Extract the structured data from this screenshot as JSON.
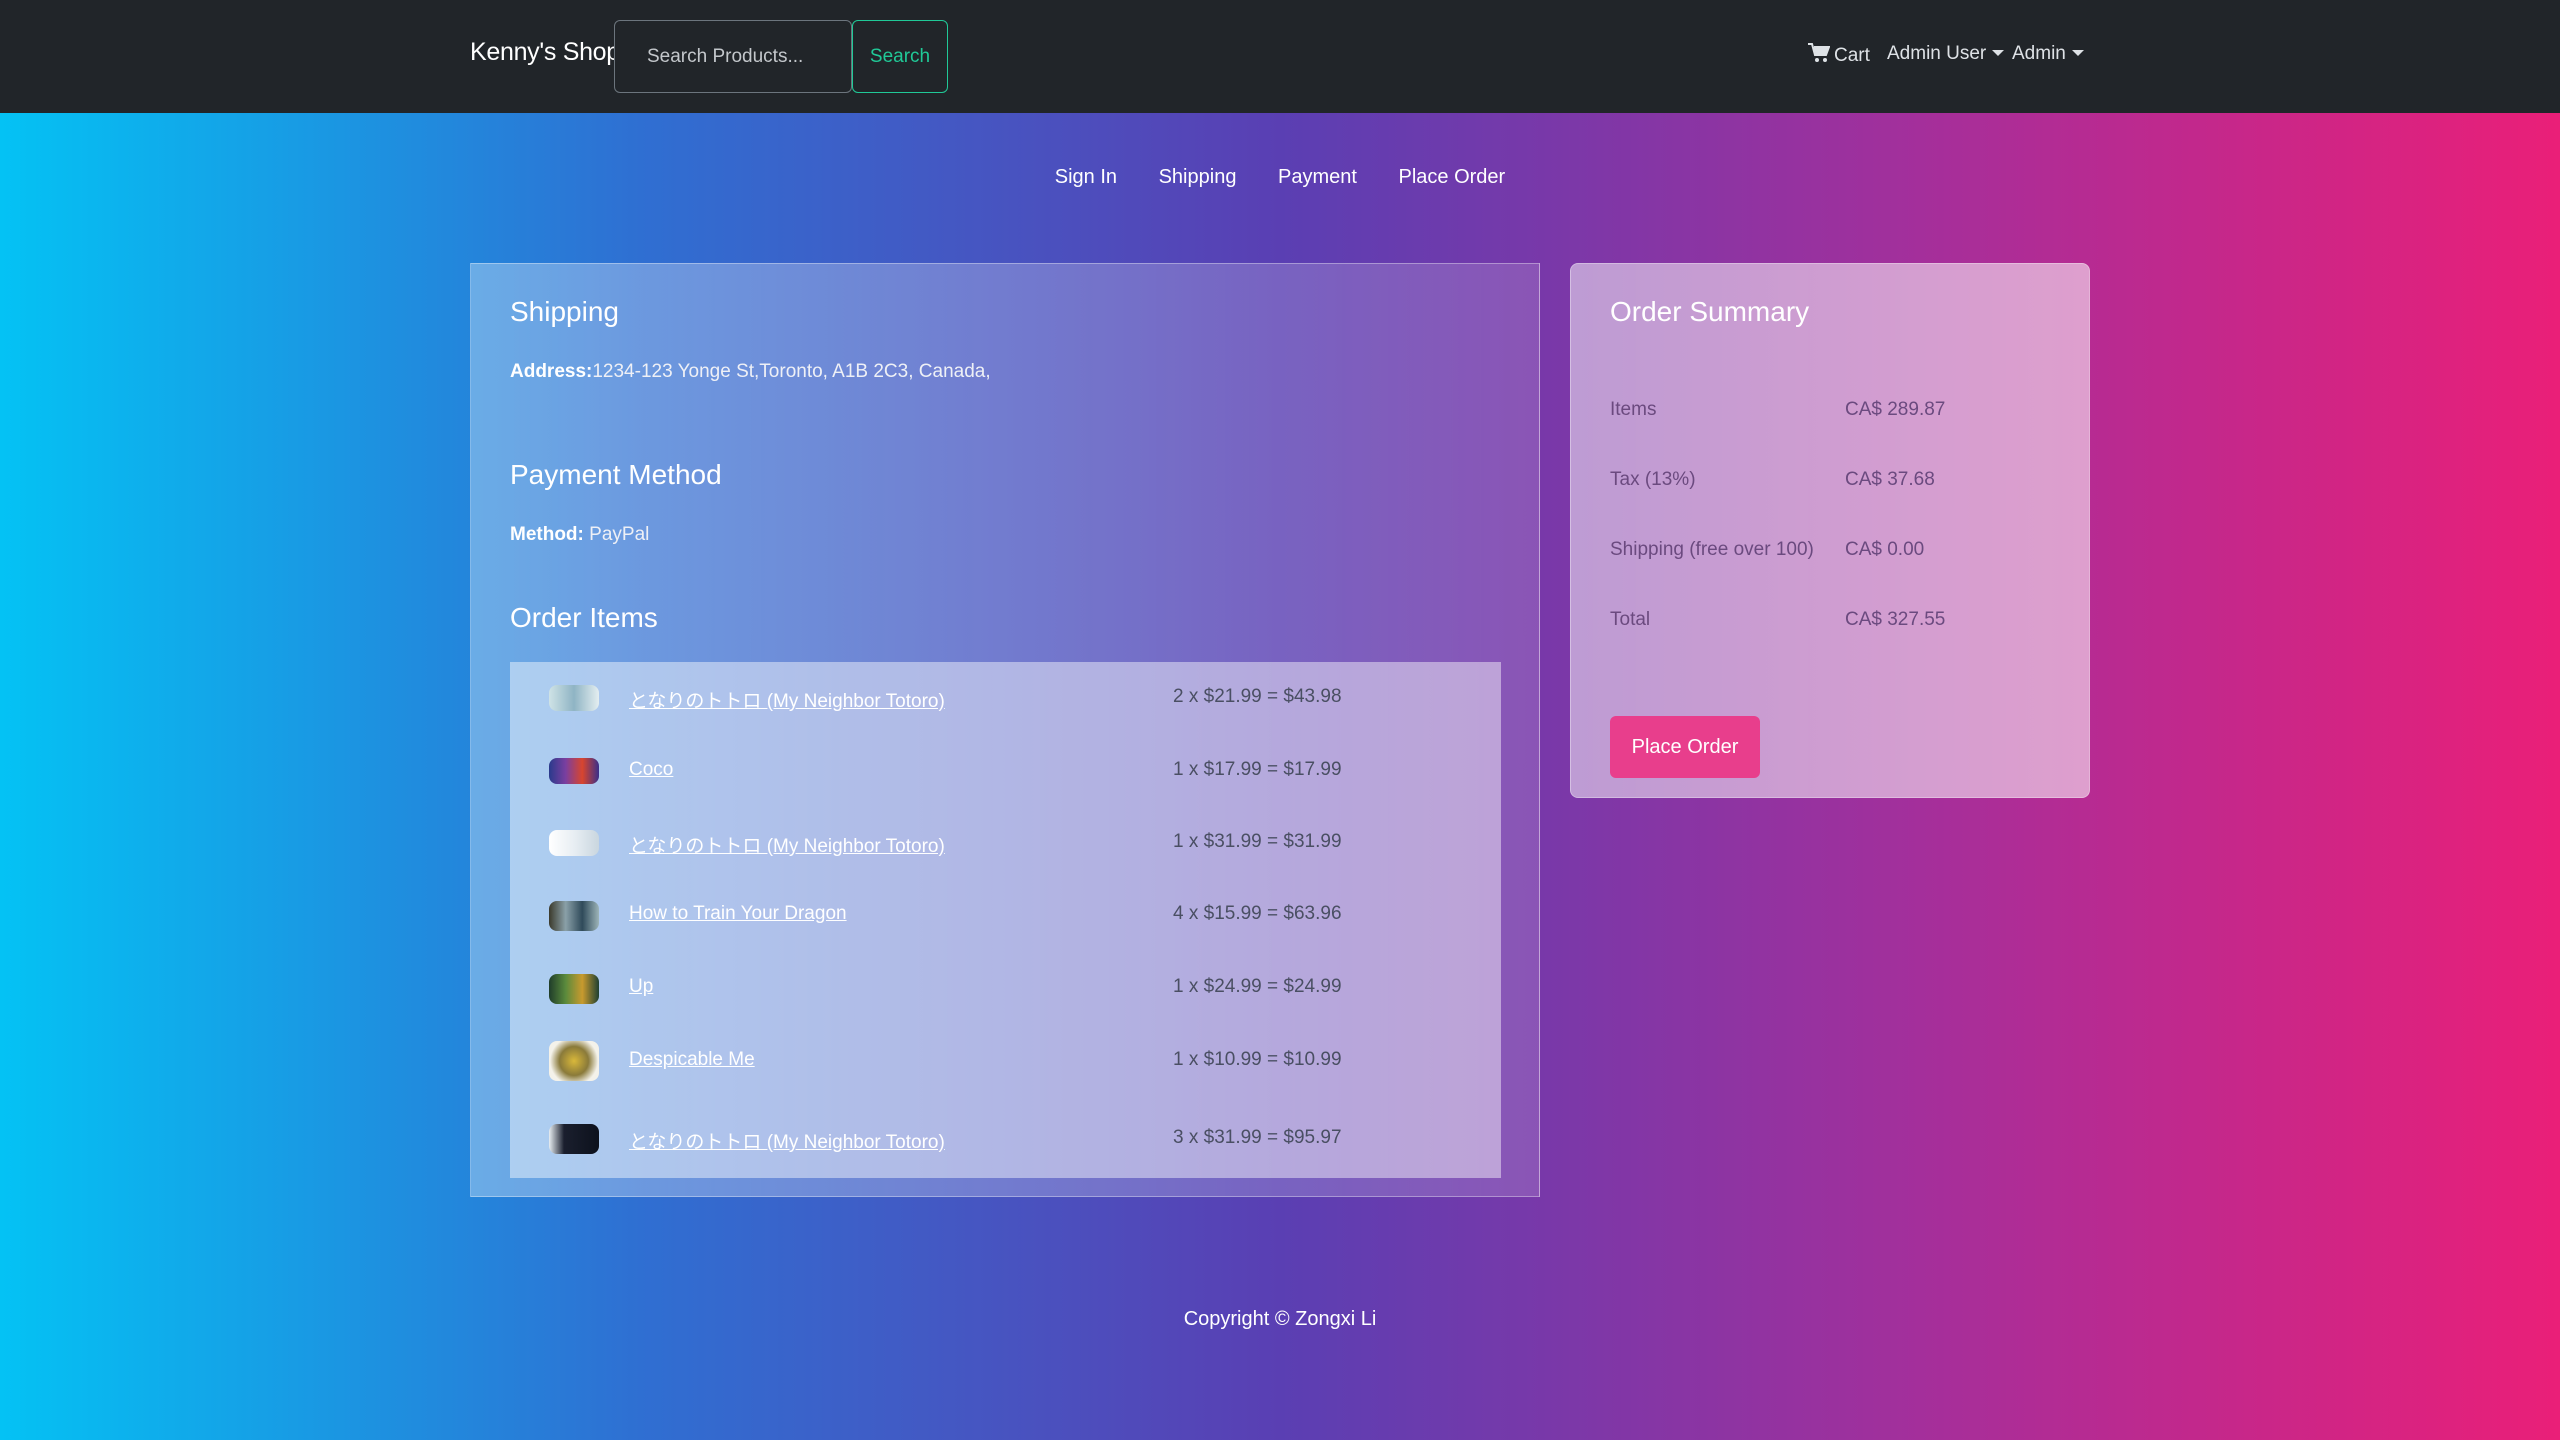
{
  "header": {
    "brand": "Kenny's Shop",
    "search_placeholder": "Search Products...",
    "search_button": "Search",
    "cart_label": "Cart",
    "user_menu": "Admin User",
    "admin_menu": "Admin"
  },
  "steps": [
    "Sign In",
    "Shipping",
    "Payment",
    "Place Order"
  ],
  "shipping": {
    "title": "Shipping",
    "address_label": "Address:",
    "address_value": "1234-123 Yonge St,Toronto, A1B 2C3, Canada,"
  },
  "payment": {
    "title": "Payment Method",
    "method_label": "Method:",
    "method_value": "PayPal"
  },
  "order_items": {
    "title": "Order Items",
    "items": [
      {
        "name": "となりのトトロ (My Neighbor Totoro)",
        "price": "2 x $21.99 = $43.98"
      },
      {
        "name": "Coco",
        "price": "1 x $17.99 = $17.99"
      },
      {
        "name": "となりのトトロ (My Neighbor Totoro)",
        "price": "1 x $31.99 = $31.99"
      },
      {
        "name": "How to Train Your Dragon",
        "price": "4 x $15.99 = $63.96"
      },
      {
        "name": "Up",
        "price": "1 x $24.99 = $24.99"
      },
      {
        "name": "Despicable Me",
        "price": "1 x $10.99 = $10.99"
      },
      {
        "name": "となりのトトロ (My Neighbor Totoro)",
        "price": "3 x $31.99 = $95.97"
      }
    ]
  },
  "summary": {
    "title": "Order Summary",
    "rows": [
      {
        "label": "Items",
        "value": "CA$ 289.87"
      },
      {
        "label": "Tax (13%)",
        "value": "CA$ 37.68"
      },
      {
        "label": "Shipping (free over 100)",
        "value": "CA$ 0.00"
      },
      {
        "label": "Total",
        "value": "CA$ 327.55"
      }
    ],
    "button": "Place Order"
  },
  "footer": "Copyright © Zongxi Li",
  "colors": {
    "navbar": "#212529",
    "search_accent": "#20c997",
    "place_order_button": "#e83e8c"
  }
}
